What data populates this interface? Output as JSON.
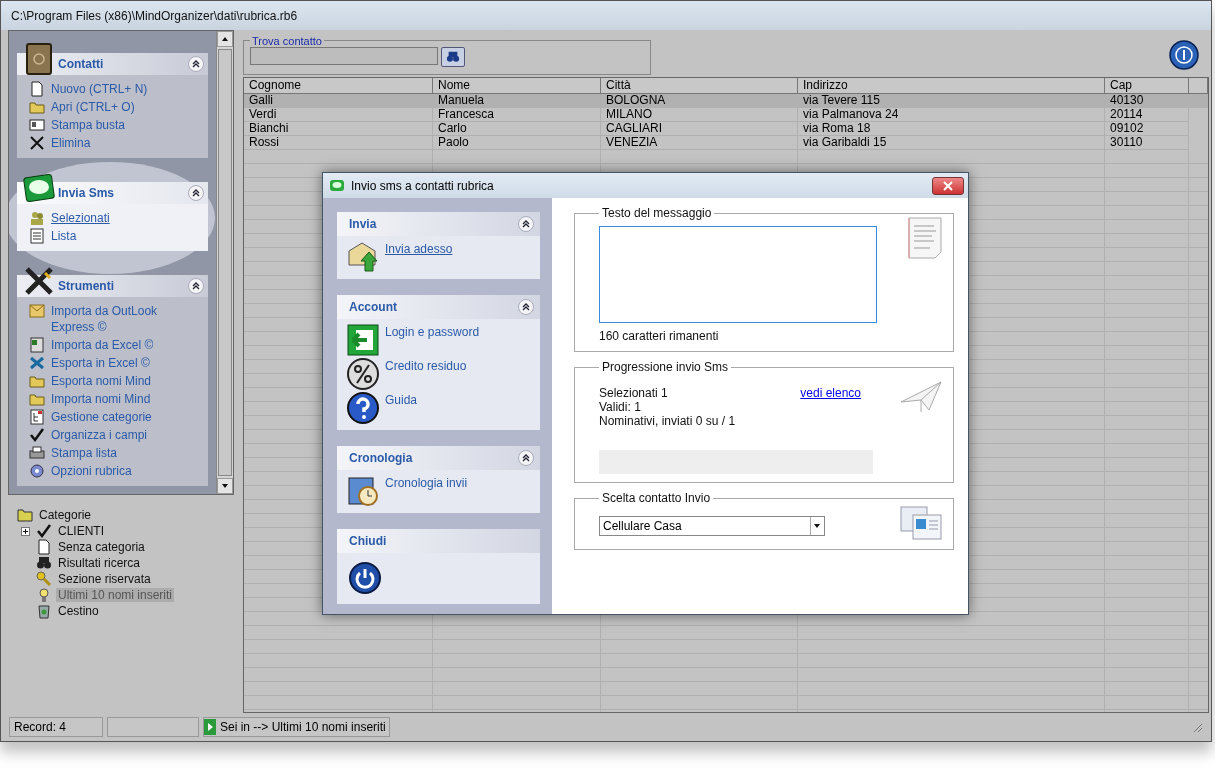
{
  "window": {
    "title": "C:\\Program Files (x86)\\MindOrganizer\\dati\\rubrica.rb6"
  },
  "sidebar": {
    "groups": [
      {
        "title": "Contatti",
        "highlighted": false,
        "items": [
          {
            "label": "Nuovo (CTRL+ N)",
            "hovered": false
          },
          {
            "label": "Apri (CTRL+ O)",
            "hovered": false
          },
          {
            "label": "Stampa busta",
            "hovered": false
          },
          {
            "label": "Elimina",
            "hovered": false
          }
        ]
      },
      {
        "title": "Invia Sms",
        "highlighted": true,
        "items": [
          {
            "label": "Selezionati",
            "hovered": true
          },
          {
            "label": "Lista",
            "hovered": false
          }
        ]
      },
      {
        "title": "Strumenti",
        "highlighted": false,
        "items": [
          {
            "label": "Importa da OutLook Express ©",
            "hovered": false
          },
          {
            "label": "Importa da Excel ©",
            "hovered": false
          },
          {
            "label": "Esporta in Excel ©",
            "hovered": false
          },
          {
            "label": "Esporta nomi Mind",
            "hovered": false
          },
          {
            "label": "Importa nomi Mind",
            "hovered": false
          },
          {
            "label": "Gestione categorie",
            "hovered": false
          },
          {
            "label": "Organizza i campi",
            "hovered": false
          },
          {
            "label": "Stampa lista",
            "hovered": false
          },
          {
            "label": "Opzioni rubrica",
            "hovered": false
          }
        ]
      }
    ]
  },
  "tree": {
    "label": "Categorie",
    "children": [
      {
        "label": "CLIENTI",
        "collapsed": true,
        "selected": false
      },
      {
        "label": "Senza categoria",
        "collapsed": false,
        "selected": false
      },
      {
        "label": "Risultati ricerca",
        "collapsed": false,
        "selected": false
      },
      {
        "label": "Sezione riservata",
        "collapsed": false,
        "selected": false
      },
      {
        "label": "Ultimi 10 nomi inseriti",
        "collapsed": false,
        "selected": true
      },
      {
        "label": "Cestino",
        "collapsed": false,
        "selected": false
      }
    ]
  },
  "search": {
    "legend": "Trova contatto"
  },
  "table": {
    "columns": [
      "Cognome",
      "Nome",
      "Città",
      "Indirizzo",
      "Cap"
    ],
    "rows": [
      {
        "cells": [
          "Galli",
          "Manuela",
          "BOLOGNA",
          "via Tevere 115",
          "40130"
        ],
        "selected": true
      },
      {
        "cells": [
          "Verdi",
          "Francesca",
          "MILANO",
          "via Palmanova 24",
          "20114"
        ],
        "selected": false
      },
      {
        "cells": [
          "Bianchi",
          "Carlo",
          "CAGLIARI",
          "via Roma 18",
          "09102"
        ],
        "selected": false
      },
      {
        "cells": [
          "Rossi",
          "Paolo",
          "VENEZIA",
          "via Garibaldi 15",
          "30110"
        ],
        "selected": false
      }
    ]
  },
  "status_bar": {
    "record": "Record: 4",
    "location": "Sei in --> Ultimi 10 nomi inseriti"
  },
  "dialog": {
    "title": "Invio sms a contatti rubrica",
    "panels": [
      {
        "title": "Invia",
        "collapsible": true,
        "items": [
          {
            "label": "Invia adesso",
            "hovered": true
          }
        ]
      },
      {
        "title": "Account",
        "collapsible": true,
        "items": [
          {
            "label": "Login e password",
            "hovered": false
          },
          {
            "label": "Credito residuo",
            "hovered": false
          },
          {
            "label": "Guida",
            "hovered": false
          }
        ]
      },
      {
        "title": "Cronologia",
        "collapsible": true,
        "items": [
          {
            "label": "Cronologia invii",
            "hovered": false
          }
        ]
      },
      {
        "title": "Chiudi",
        "collapsible": false
      }
    ],
    "message": {
      "legend": "Testo del messaggio",
      "focused": true,
      "remaining": "160 caratteri rimanenti"
    },
    "progress": {
      "legend": "Progressione invio Sms",
      "lines": [
        "Selezionati 1",
        "Validi: 1",
        "Nominativi, inviati 0 su / 1"
      ],
      "link": "vedi elenco",
      "level": 0
    },
    "contact": {
      "legend": "Scelta contatto Invio",
      "value": "Cellulare Casa"
    }
  }
}
